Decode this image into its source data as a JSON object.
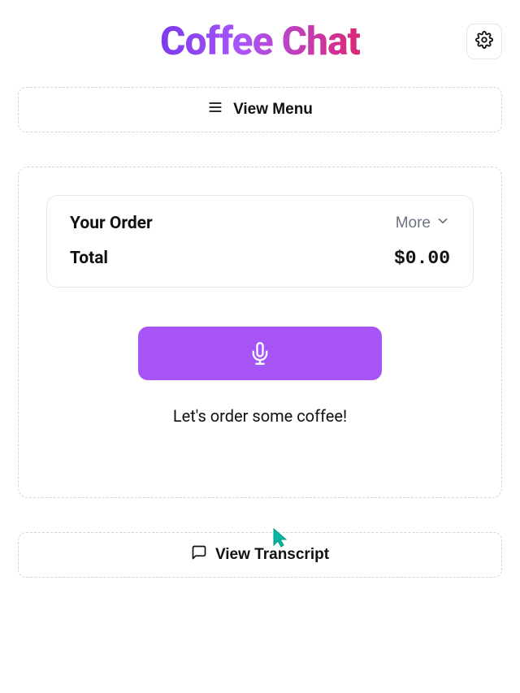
{
  "header": {
    "title": "Coffee Chat"
  },
  "menu_button": {
    "label": "View Menu"
  },
  "order": {
    "heading": "Your Order",
    "more_label": "More",
    "total_label": "Total",
    "total_value": "$0.00"
  },
  "prompt": {
    "text": "Let's order some coffee!"
  },
  "transcript_button": {
    "label": "View Transcript"
  },
  "colors": {
    "accent": "#a855f7"
  }
}
